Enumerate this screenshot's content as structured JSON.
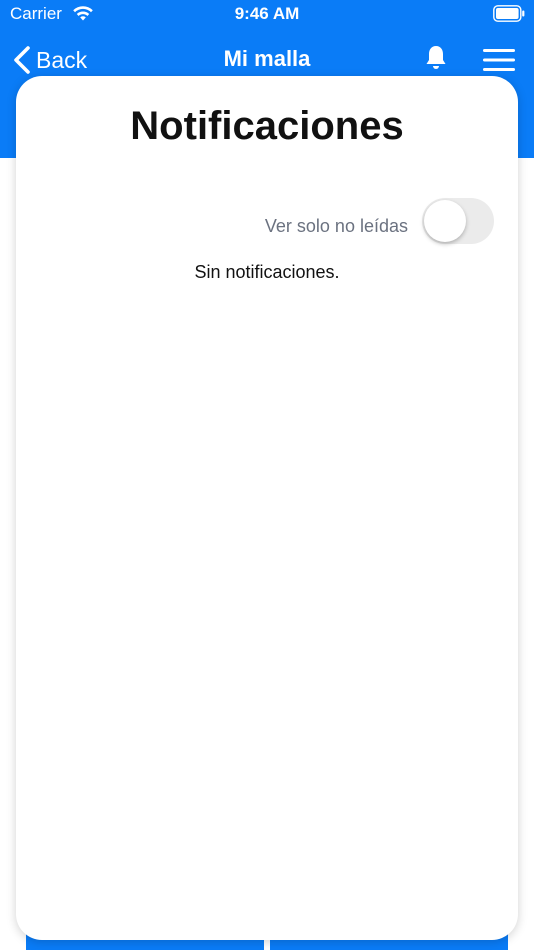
{
  "status_bar": {
    "carrier": "Carrier",
    "time": "9:46 AM",
    "wifi_icon": "wifi-icon",
    "battery_icon": "battery-icon"
  },
  "nav": {
    "back_label": "Back",
    "title": "Mi malla",
    "bell_icon": "bell-icon",
    "menu_icon": "hamburger-menu-icon"
  },
  "modal": {
    "title": "Notificaciones",
    "filter_label": "Ver solo no leídas",
    "filter_on": false,
    "empty_message": "Sin notificaciones."
  },
  "colors": {
    "brand_blue": "#0a7cf7",
    "toggle_off": "#ebebeb"
  }
}
